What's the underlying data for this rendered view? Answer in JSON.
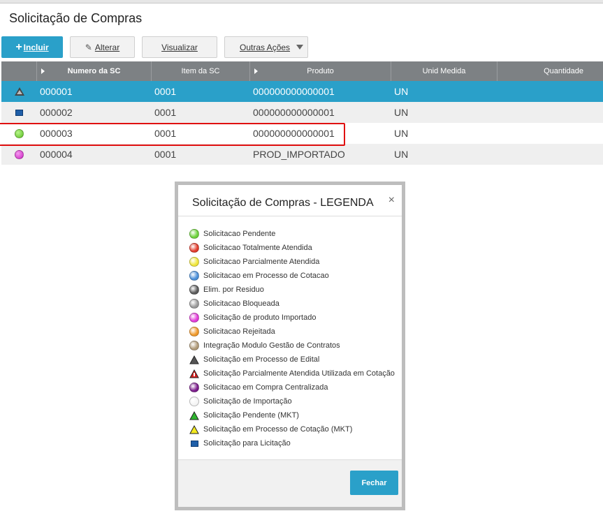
{
  "page": {
    "title": "Solicitação de Compras"
  },
  "toolbar": {
    "incluir": "Incluir",
    "alterar": "Alterar",
    "visualizar": "Visualizar",
    "outras": "Outras Ações"
  },
  "grid": {
    "headers": [
      "Numero da SC",
      "Item da SC",
      "Produto",
      "Unid Medida",
      "Quantidade"
    ],
    "rows": [
      {
        "status": "gray-triangle",
        "numero": "000001",
        "item": "0001",
        "produto": "000000000000001",
        "unid": "UN"
      },
      {
        "status": "blue-square",
        "numero": "000002",
        "item": "0001",
        "produto": "000000000000001",
        "unid": "UN"
      },
      {
        "status": "green",
        "numero": "000003",
        "item": "0001",
        "produto": "000000000000001",
        "unid": "UN"
      },
      {
        "status": "magenta",
        "numero": "000004",
        "item": "0001",
        "produto": "PROD_IMPORTADO",
        "unid": "UN"
      }
    ]
  },
  "modal": {
    "title": "Solicitação de Compras - LEGENDA",
    "close": "×",
    "button": "Fechar",
    "items": [
      {
        "icon": "green-dot",
        "color": "#6cd23a",
        "label": "Solicitacao Pendente"
      },
      {
        "icon": "red-dot",
        "color": "#e23a2a",
        "label": "Solicitacao Totalmente Atendida"
      },
      {
        "icon": "yellow-dot",
        "color": "#f0e63a",
        "label": "Solicitacao Parcialmente Atendida"
      },
      {
        "icon": "blue-dot",
        "color": "#4a8fd9",
        "label": "Solicitacao em Processo de Cotacao"
      },
      {
        "icon": "dark-gray-dot",
        "color": "#5a5a5a",
        "label": "Elim. por Residuo"
      },
      {
        "icon": "gray-dot",
        "color": "#9a9a9a",
        "label": "Solicitacao Bloqueada"
      },
      {
        "icon": "magenta-dot",
        "color": "#e23ad8",
        "label": "Solicitação de produto Importado"
      },
      {
        "icon": "orange-dot",
        "color": "#f0992a",
        "label": "Solicitacao Rejeitada"
      },
      {
        "icon": "tan-dot",
        "color": "#b09a78",
        "label": "Integração Modulo Gestão de Contratos"
      },
      {
        "icon": "gray-triangle",
        "color": "#555555",
        "label": "Solicitação em Processo de Edital"
      },
      {
        "icon": "red-warning-triangle",
        "color": "#d42020",
        "label": "Solicitação Parcialmente Atendida Utilizada em Cotação"
      },
      {
        "icon": "purple-dot",
        "color": "#7a1a8a",
        "label": "Solicitacao em Compra Centralizada"
      },
      {
        "icon": "white-dot",
        "color": "#f4f4f4",
        "label": "Solicitação de Importação"
      },
      {
        "icon": "green-triangle",
        "color": "#2fb52f",
        "label": "Solicitação Pendente (MKT)"
      },
      {
        "icon": "yellow-triangle",
        "color": "#f4ea20",
        "label": "Solicitação em Processo de Cotação (MKT)"
      },
      {
        "icon": "blue-square",
        "color": "#1f5fa8",
        "label": "Solicitação para Licitação"
      }
    ]
  }
}
